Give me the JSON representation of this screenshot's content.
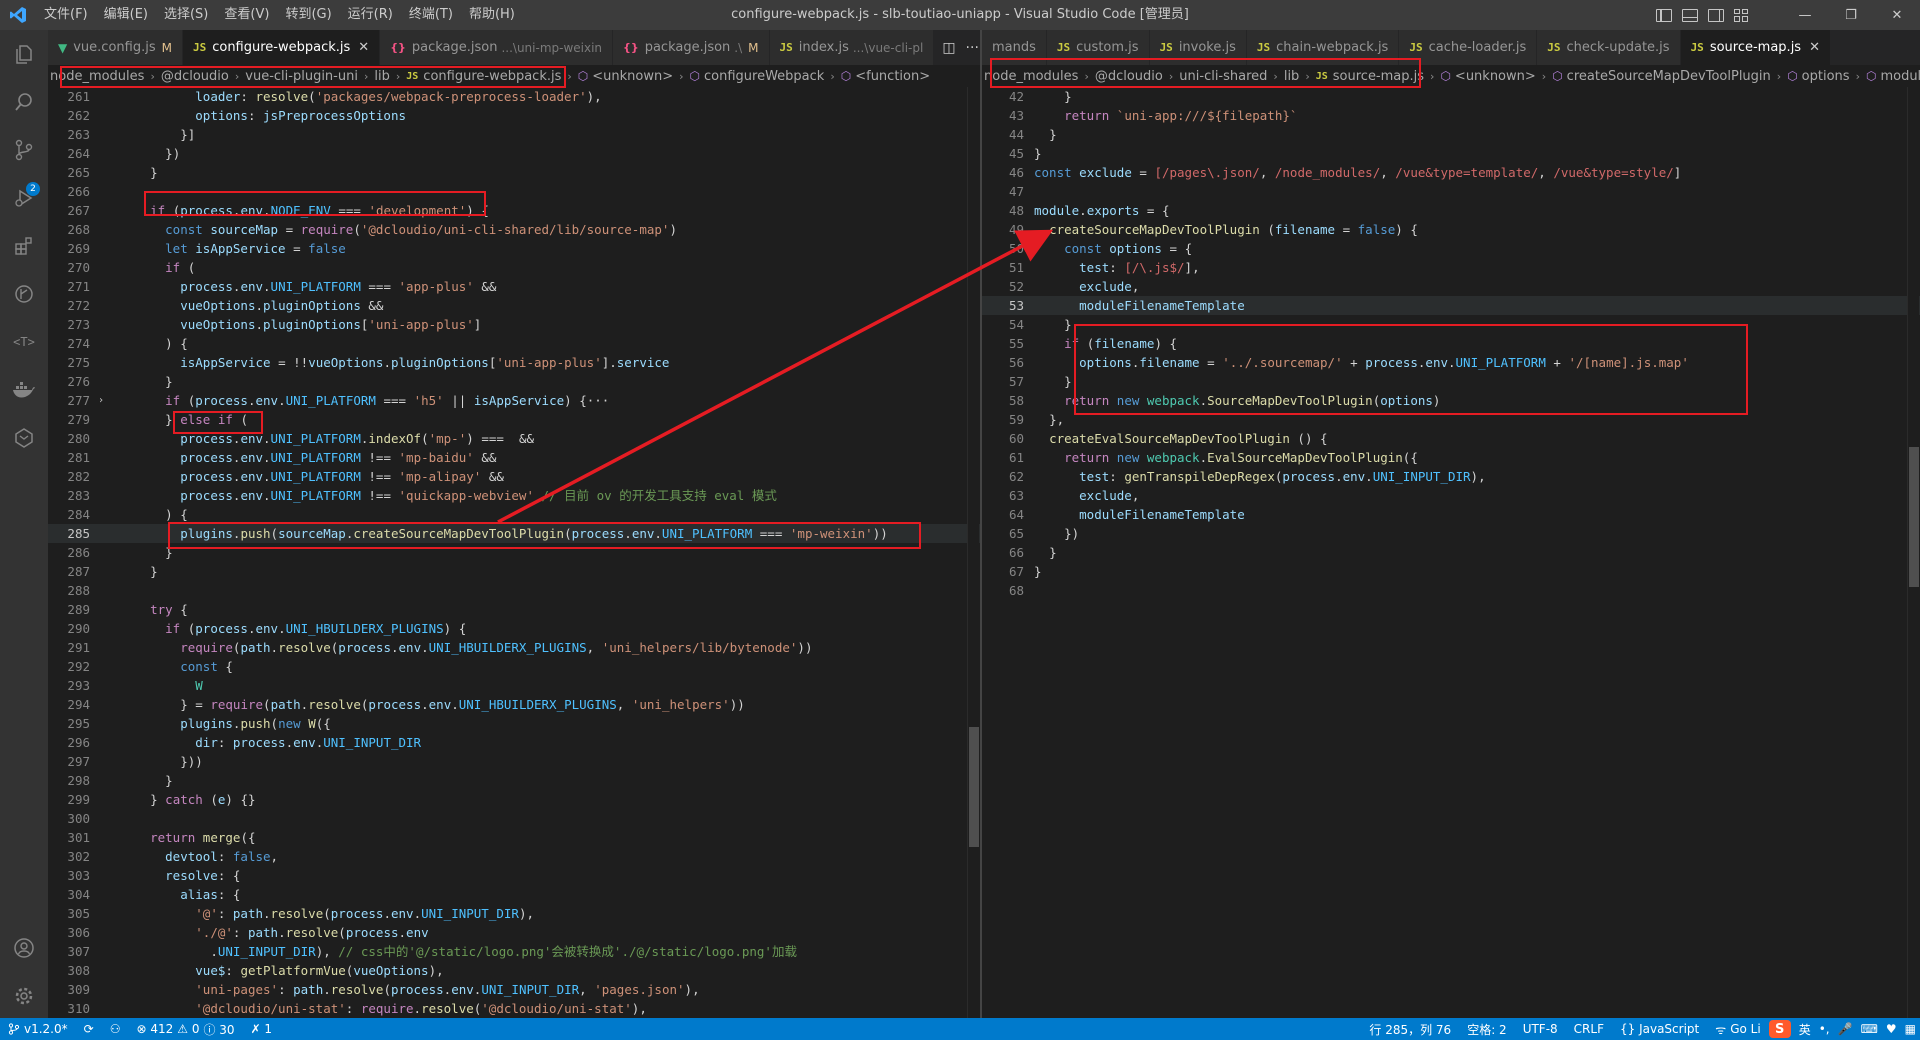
{
  "window": {
    "title": "configure-webpack.js - slb-toutiao-uniapp - Visual Studio Code [管理员]",
    "menu": [
      "文件(F)",
      "编辑(E)",
      "选择(S)",
      "查看(V)",
      "转到(G)",
      "运行(R)",
      "终端(T)",
      "帮助(H)"
    ],
    "controls": {
      "minimize": "—",
      "restore": "❐",
      "close": "✕"
    }
  },
  "left_group": {
    "tabs": [
      {
        "icon": "vue-icon",
        "label": "vue.config.js",
        "desc": "",
        "mod": "M",
        "active": false
      },
      {
        "icon": "js-icon",
        "label": "configure-webpack.js",
        "desc": "",
        "mod": "",
        "active": true,
        "close": "✕"
      },
      {
        "icon": "json-icon",
        "label": "package.json",
        "desc": "...\\uni-mp-weixin",
        "mod": "",
        "active": false
      },
      {
        "icon": "json-icon",
        "label": "package.json",
        "desc": ".\\",
        "mod": "M",
        "active": false
      },
      {
        "icon": "js-icon",
        "label": "index.js",
        "desc": "...\\vue-cli-pl",
        "mod": "",
        "active": false
      }
    ],
    "breadcrumb": [
      {
        "text": "node_modules",
        "kind": "folder"
      },
      {
        "text": "@dcloudio",
        "kind": "folder"
      },
      {
        "text": "vue-cli-plugin-uni",
        "kind": "folder"
      },
      {
        "text": "lib",
        "kind": "folder"
      },
      {
        "text": "configure-webpack.js",
        "kind": "js"
      },
      {
        "text": "<unknown>",
        "kind": "symbol"
      },
      {
        "text": "configureWebpack",
        "kind": "symbol"
      },
      {
        "text": "<function>",
        "kind": "symbol"
      }
    ],
    "current_line": 285,
    "lines": [
      {
        "n": 261,
        "t": "          loader: resolve('packages/webpack-preprocess-loader'),"
      },
      {
        "n": 262,
        "t": "          options: jsPreprocessOptions"
      },
      {
        "n": 263,
        "t": "        }]"
      },
      {
        "n": 264,
        "t": "      })"
      },
      {
        "n": 265,
        "t": "    }"
      },
      {
        "n": 266,
        "t": ""
      },
      {
        "n": 267,
        "t": "    if (process.env.NODE_ENV === 'development') {"
      },
      {
        "n": 268,
        "t": "      const sourceMap = require('@dcloudio/uni-cli-shared/lib/source-map')"
      },
      {
        "n": 269,
        "t": "      let isAppService = false"
      },
      {
        "n": 270,
        "t": "      if ("
      },
      {
        "n": 271,
        "t": "        process.env.UNI_PLATFORM === 'app-plus' &&"
      },
      {
        "n": 272,
        "t": "        vueOptions.pluginOptions &&"
      },
      {
        "n": 273,
        "t": "        vueOptions.pluginOptions['uni-app-plus']"
      },
      {
        "n": 274,
        "t": "      ) {"
      },
      {
        "n": 275,
        "t": "        isAppService = !!vueOptions.pluginOptions['uni-app-plus'].service"
      },
      {
        "n": 276,
        "t": "      }"
      },
      {
        "n": 277,
        "t": "      if (process.env.UNI_PLATFORM === 'h5' || isAppService) {···",
        "fold": "›"
      },
      {
        "n": 279,
        "t": "      } else if ("
      },
      {
        "n": 280,
        "t": "        process.env.UNI_PLATFORM.indexOf('mp-') === 0 &&"
      },
      {
        "n": 281,
        "t": "        process.env.UNI_PLATFORM !== 'mp-baidu' &&"
      },
      {
        "n": 282,
        "t": "        process.env.UNI_PLATFORM !== 'mp-alipay' &&"
      },
      {
        "n": 283,
        "t": "        process.env.UNI_PLATFORM !== 'quickapp-webview' // 目前 ov 的开发工具支持 eval 模式"
      },
      {
        "n": 284,
        "t": "      ) {"
      },
      {
        "n": 285,
        "t": "        plugins.push(sourceMap.createSourceMapDevToolPlugin(process.env.UNI_PLATFORM === 'mp-weixin'))"
      },
      {
        "n": 286,
        "t": "      }"
      },
      {
        "n": 287,
        "t": "    }"
      },
      {
        "n": 288,
        "t": ""
      },
      {
        "n": 289,
        "t": "    try {"
      },
      {
        "n": 290,
        "t": "      if (process.env.UNI_HBUILDERX_PLUGINS) {"
      },
      {
        "n": 291,
        "t": "        require(path.resolve(process.env.UNI_HBUILDERX_PLUGINS, 'uni_helpers/lib/bytenode'))"
      },
      {
        "n": 292,
        "t": "        const {"
      },
      {
        "n": 293,
        "t": "          W"
      },
      {
        "n": 294,
        "t": "        } = require(path.resolve(process.env.UNI_HBUILDERX_PLUGINS, 'uni_helpers'))"
      },
      {
        "n": 295,
        "t": "        plugins.push(new W({"
      },
      {
        "n": 296,
        "t": "          dir: process.env.UNI_INPUT_DIR"
      },
      {
        "n": 297,
        "t": "        }))"
      },
      {
        "n": 298,
        "t": "      }"
      },
      {
        "n": 299,
        "t": "    } catch (e) {}"
      },
      {
        "n": 300,
        "t": ""
      },
      {
        "n": 301,
        "t": "    return merge({"
      },
      {
        "n": 302,
        "t": "      devtool: false,"
      },
      {
        "n": 303,
        "t": "      resolve: {"
      },
      {
        "n": 304,
        "t": "        alias: {"
      },
      {
        "n": 305,
        "t": "          '@': path.resolve(process.env.UNI_INPUT_DIR),"
      },
      {
        "n": 306,
        "t": "          './@': path.resolve(process.env"
      },
      {
        "n": 307,
        "t": "            .UNI_INPUT_DIR), // css中的'@/static/logo.png'会被转换成'./@/static/logo.png'加载"
      },
      {
        "n": 308,
        "t": "          vue$: getPlatformVue(vueOptions),"
      },
      {
        "n": 309,
        "t": "          'uni-pages': path.resolve(process.env.UNI_INPUT_DIR, 'pages.json'),"
      },
      {
        "n": 310,
        "t": "          '@dcloudio/uni-stat': require.resolve('@dcloudio/uni-stat'),"
      }
    ]
  },
  "right_group": {
    "tabs": [
      {
        "icon": "",
        "label": "mands",
        "desc": "",
        "mod": "",
        "active": false
      },
      {
        "icon": "js-icon",
        "label": "custom.js",
        "desc": "",
        "mod": "",
        "active": false
      },
      {
        "icon": "js-icon",
        "label": "invoke.js",
        "desc": "",
        "mod": "",
        "active": false
      },
      {
        "icon": "js-icon",
        "label": "chain-webpack.js",
        "desc": "",
        "mod": "",
        "active": false
      },
      {
        "icon": "js-icon",
        "label": "cache-loader.js",
        "desc": "",
        "mod": "",
        "active": false
      },
      {
        "icon": "js-icon",
        "label": "check-update.js",
        "desc": "",
        "mod": "",
        "active": false
      },
      {
        "icon": "js-icon",
        "label": "source-map.js",
        "desc": "",
        "mod": "",
        "active": true,
        "close": "✕"
      }
    ],
    "breadcrumb": [
      {
        "text": "node_modules",
        "kind": "folder"
      },
      {
        "text": "@dcloudio",
        "kind": "folder"
      },
      {
        "text": "uni-cli-shared",
        "kind": "folder"
      },
      {
        "text": "lib",
        "kind": "folder"
      },
      {
        "text": "source-map.js",
        "kind": "js"
      },
      {
        "text": "<unknown>",
        "kind": "symbol"
      },
      {
        "text": "createSourceMapDevToolPlugin",
        "kind": "symbol"
      },
      {
        "text": "options",
        "kind": "symbol"
      },
      {
        "text": "moduleFilenam",
        "kind": "symbol"
      }
    ],
    "current_line": 53,
    "lines": [
      {
        "n": 42,
        "t": "    }"
      },
      {
        "n": 43,
        "t": "    return `uni-app:///${filepath}`"
      },
      {
        "n": 44,
        "t": "  }"
      },
      {
        "n": 45,
        "t": "}"
      },
      {
        "n": 46,
        "t": "const exclude = [/pages\\.json/, /node_modules/, /vue&type=template/, /vue&type=style/]"
      },
      {
        "n": 47,
        "t": ""
      },
      {
        "n": 48,
        "t": "module.exports = {"
      },
      {
        "n": 49,
        "t": "  createSourceMapDevToolPlugin (filename = false) {"
      },
      {
        "n": 50,
        "t": "    const options = {"
      },
      {
        "n": 51,
        "t": "      test: [/\\.js$/],"
      },
      {
        "n": 52,
        "t": "      exclude,"
      },
      {
        "n": 53,
        "t": "      moduleFilenameTemplate"
      },
      {
        "n": 54,
        "t": "    }"
      },
      {
        "n": 55,
        "t": "    if (filename) {"
      },
      {
        "n": 56,
        "t": "      options.filename = '../.sourcemap/' + process.env.UNI_PLATFORM + '/[name].js.map'"
      },
      {
        "n": 57,
        "t": "    }"
      },
      {
        "n": 58,
        "t": "    return new webpack.SourceMapDevToolPlugin(options)"
      },
      {
        "n": 59,
        "t": "  },"
      },
      {
        "n": 60,
        "t": "  createEvalSourceMapDevToolPlugin () {"
      },
      {
        "n": 61,
        "t": "    return new webpack.EvalSourceMapDevToolPlugin({"
      },
      {
        "n": 62,
        "t": "      test: genTranspileDepRegex(process.env.UNI_INPUT_DIR),"
      },
      {
        "n": 63,
        "t": "      exclude,"
      },
      {
        "n": 64,
        "t": "      moduleFilenameTemplate"
      },
      {
        "n": 65,
        "t": "    })"
      },
      {
        "n": 66,
        "t": "  }"
      },
      {
        "n": 67,
        "t": "}"
      },
      {
        "n": 68,
        "t": ""
      }
    ]
  },
  "statusbar": {
    "branch": "v1.2.0*",
    "sync": "⟳",
    "errors": "⊗ 412",
    "warnings": "⚠ 0",
    "infos": "ⓘ 30",
    "ports": "✗ 1",
    "position": "行 285，列 76",
    "spaces": "空格: 2",
    "encoding": "UTF-8",
    "eol": "CRLF",
    "language": "{} JavaScript",
    "golive": "Go Li",
    "ime_label": "英"
  },
  "colors": {
    "accent": "#007acc",
    "highlight_box": "#e51c23",
    "keyword": "#569cd6",
    "control": "#c586c0",
    "string": "#ce9178",
    "variable": "#9cdcfe",
    "function": "#dcdcaa",
    "comment": "#6a9955",
    "regex": "#d16969",
    "class": "#4ec9b0",
    "constant": "#4fc1ff",
    "number": "#b5cea8"
  }
}
